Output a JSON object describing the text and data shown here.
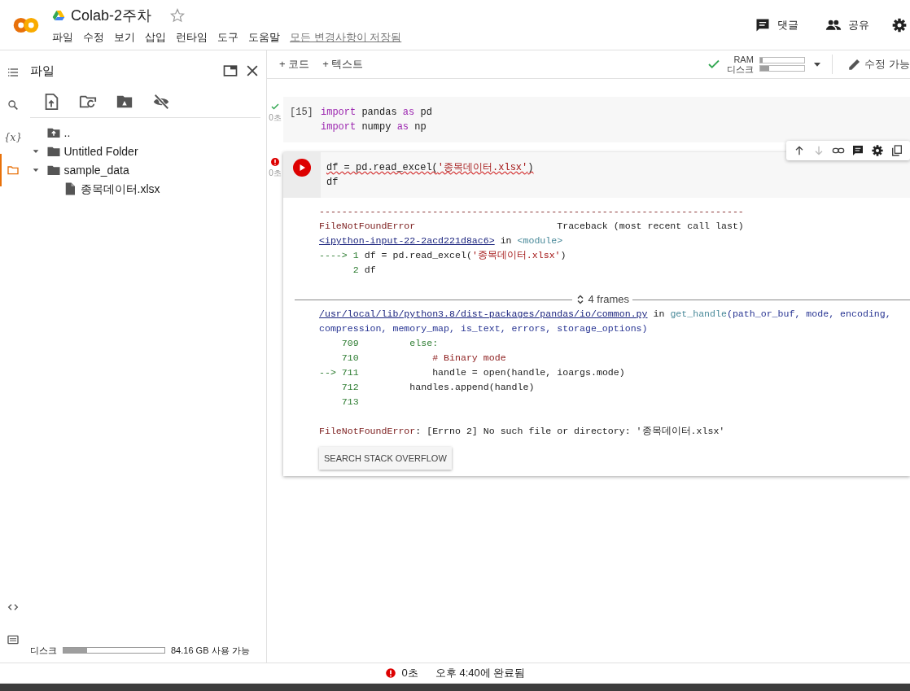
{
  "header": {
    "title": "Colab-2주차",
    "starred": false,
    "menu": [
      "파일",
      "수정",
      "보기",
      "삽입",
      "런타임",
      "도구",
      "도움말"
    ],
    "save_status": "모든 변경사항이 저장됨",
    "actions": [
      {
        "kind": "comment",
        "label": "댓글"
      },
      {
        "kind": "share",
        "label": "공유"
      },
      {
        "kind": "settings"
      }
    ]
  },
  "rail": [
    {
      "kind": "toc",
      "selected": false
    },
    {
      "kind": "search",
      "selected": false
    },
    {
      "kind": "variables",
      "label": "{x}",
      "selected": false
    },
    {
      "kind": "files",
      "selected": true
    }
  ],
  "rail_bottom": [
    {
      "kind": "code"
    },
    {
      "kind": "terminal"
    }
  ],
  "sidebar": {
    "title": "파일",
    "tools": [
      {
        "kind": "upload"
      },
      {
        "kind": "refresh"
      },
      {
        "kind": "drive"
      },
      {
        "kind": "hide"
      }
    ],
    "tree": [
      {
        "kind": "parent",
        "name": ".."
      },
      {
        "kind": "folder",
        "name": "Untitled Folder",
        "expanded": true
      },
      {
        "kind": "folder",
        "name": "sample_data",
        "expanded": true,
        "children": [
          {
            "kind": "file",
            "name": "종목데이터.xlsx"
          }
        ]
      }
    ],
    "disk": {
      "label": "디스크",
      "level": 0.23,
      "reading": "84.16 GB 사용 가능"
    }
  },
  "toolbar": {
    "add": [
      "+ 코드",
      "+ 텍스트"
    ],
    "connected": true,
    "ram": {
      "label": "RAM",
      "level": 0.05
    },
    "disk": {
      "label": "디스크",
      "level": 0.2
    },
    "edit": "수정 가능"
  },
  "cells": [
    {
      "failed": false,
      "count": "[15]",
      "time": "0초",
      "selected": false,
      "lines": [
        {
          "flagged": false,
          "segs": [
            {
              "kind": "kw",
              "t": "import"
            },
            {
              "kind": "id",
              "t": " pandas "
            },
            {
              "kind": "kw",
              "t": "as"
            },
            {
              "kind": "id",
              "t": " pd"
            }
          ]
        },
        {
          "flagged": false,
          "segs": [
            {
              "kind": "kw",
              "t": "import"
            },
            {
              "kind": "id",
              "t": " numpy "
            },
            {
              "kind": "kw",
              "t": "as"
            },
            {
              "kind": "id",
              "t": " np"
            }
          ]
        }
      ]
    },
    {
      "failed": true,
      "time": "0초",
      "selected": true,
      "lines": [
        {
          "flagged": true,
          "segs": [
            {
              "kind": "id",
              "t": "df = pd.read_excel("
            },
            {
              "kind": "str",
              "t": "'종목데이터.xlsx'"
            },
            {
              "kind": "id",
              "t": ")"
            }
          ]
        },
        {
          "flagged": false,
          "segs": [
            {
              "kind": "id",
              "t": "df"
            }
          ]
        }
      ],
      "output": [
        {
          "kind": "line",
          "segs": [
            {
              "kind": "err",
              "t": "---------------------------------------------------------------------------"
            }
          ]
        },
        {
          "kind": "line",
          "segs": [
            {
              "kind": "err",
              "t": "FileNotFoundError"
            },
            {
              "kind": "id",
              "t": "                         Traceback (most recent call last)"
            }
          ]
        },
        {
          "kind": "line",
          "segs": [
            {
              "kind": "lnk",
              "t": "<ipython-input-22-2acd221d8ac6>"
            },
            {
              "kind": "id",
              "t": " in "
            },
            {
              "kind": "tl",
              "t": "<module>"
            }
          ]
        },
        {
          "kind": "line",
          "segs": [
            {
              "kind": "grn",
              "t": "----> 1 "
            },
            {
              "kind": "id",
              "t": "df = pd.read_excel("
            },
            {
              "kind": "str",
              "t": "'종목데이터.xlsx'"
            },
            {
              "kind": "id",
              "t": ")"
            }
          ]
        },
        {
          "kind": "line",
          "segs": [
            {
              "kind": "grn",
              "t": "      2 "
            },
            {
              "kind": "id",
              "t": "df"
            }
          ]
        },
        {
          "kind": "blank"
        },
        {
          "kind": "frames",
          "label": "4 frames"
        },
        {
          "kind": "line",
          "segs": [
            {
              "kind": "lnk",
              "t": "/usr/local/lib/python3.8/dist-packages/pandas/io/common.py"
            },
            {
              "kind": "id",
              "t": " in "
            },
            {
              "kind": "tl",
              "t": "get_handle"
            },
            {
              "kind": "arg",
              "t": "(path_or_buf, mode, encoding,"
            }
          ]
        },
        {
          "kind": "line",
          "segs": [
            {
              "kind": "arg",
              "t": "compression, memory_map, is_text, errors, storage_options)"
            }
          ]
        },
        {
          "kind": "line",
          "segs": [
            {
              "kind": "grn",
              "t": "    709         else:"
            }
          ]
        },
        {
          "kind": "line",
          "segs": [
            {
              "kind": "grn",
              "t": "    710             "
            },
            {
              "kind": "cmt",
              "t": "# Binary mode"
            }
          ]
        },
        {
          "kind": "line",
          "segs": [
            {
              "kind": "grn",
              "t": "--> 711             "
            },
            {
              "kind": "id",
              "t": "handle = open(handle, ioargs.mode)"
            }
          ]
        },
        {
          "kind": "line",
          "segs": [
            {
              "kind": "grn",
              "t": "    712         "
            },
            {
              "kind": "id",
              "t": "handles.append(handle)"
            }
          ]
        },
        {
          "kind": "line",
          "segs": [
            {
              "kind": "grn",
              "t": "    713"
            }
          ]
        },
        {
          "kind": "blank"
        },
        {
          "kind": "line",
          "segs": [
            {
              "kind": "err",
              "t": "FileNotFoundError"
            },
            {
              "kind": "id",
              "t": ": [Errno 2] No such file or directory: '종목데이터.xlsx'"
            }
          ]
        },
        {
          "kind": "button",
          "label": "SEARCH STACK OVERFLOW"
        }
      ]
    }
  ],
  "status_bar": {
    "failed": true,
    "time": "0초",
    "message": "오후 4:40에 완료됨"
  }
}
